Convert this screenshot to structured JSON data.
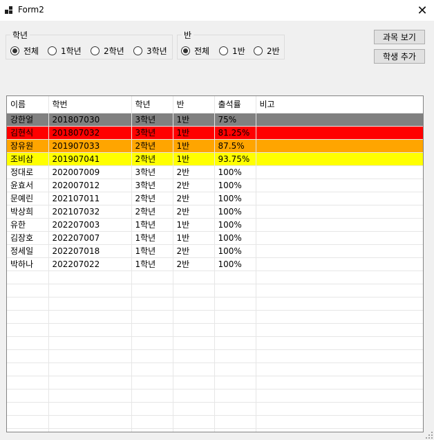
{
  "window": {
    "title": "Form2",
    "close_glyph": "✕"
  },
  "grade_group": {
    "label": "학년",
    "options": [
      {
        "label": "전체",
        "checked": true
      },
      {
        "label": "1학년",
        "checked": false
      },
      {
        "label": "2학년",
        "checked": false
      },
      {
        "label": "3학년",
        "checked": false
      }
    ]
  },
  "class_group": {
    "label": "반",
    "options": [
      {
        "label": "전체",
        "checked": true
      },
      {
        "label": "1반",
        "checked": false
      },
      {
        "label": "2반",
        "checked": false
      }
    ]
  },
  "buttons": {
    "view_subjects": "과목 보기",
    "add_student": "학생 추가"
  },
  "table": {
    "columns": [
      "이름",
      "학번",
      "학년",
      "반",
      "출석률",
      "비고"
    ],
    "rows": [
      {
        "name": "강한얼",
        "id": "201807030",
        "grade": "3학년",
        "class": "1반",
        "attendance": "75%",
        "note": "",
        "highlight": "#808080"
      },
      {
        "name": "김현식",
        "id": "201807032",
        "grade": "3학년",
        "class": "1반",
        "attendance": "81.25%",
        "note": "",
        "highlight": "#ff0000"
      },
      {
        "name": "장유원",
        "id": "201907033",
        "grade": "2학년",
        "class": "1반",
        "attendance": "87.5%",
        "note": "",
        "highlight": "#ffa500"
      },
      {
        "name": "조비삼",
        "id": "201907041",
        "grade": "2학년",
        "class": "1반",
        "attendance": "93.75%",
        "note": "",
        "highlight": "#ffff00"
      },
      {
        "name": "정대로",
        "id": "202007009",
        "grade": "3학년",
        "class": "2반",
        "attendance": "100%",
        "note": "",
        "highlight": ""
      },
      {
        "name": "윤효서",
        "id": "202007012",
        "grade": "3학년",
        "class": "2반",
        "attendance": "100%",
        "note": "",
        "highlight": ""
      },
      {
        "name": "문예린",
        "id": "202107011",
        "grade": "2학년",
        "class": "2반",
        "attendance": "100%",
        "note": "",
        "highlight": ""
      },
      {
        "name": "박상희",
        "id": "202107032",
        "grade": "2학년",
        "class": "2반",
        "attendance": "100%",
        "note": "",
        "highlight": ""
      },
      {
        "name": "유한",
        "id": "202207003",
        "grade": "1학년",
        "class": "1반",
        "attendance": "100%",
        "note": "",
        "highlight": ""
      },
      {
        "name": "김장호",
        "id": "202207007",
        "grade": "1학년",
        "class": "1반",
        "attendance": "100%",
        "note": "",
        "highlight": ""
      },
      {
        "name": "정세일",
        "id": "202207018",
        "grade": "1학년",
        "class": "2반",
        "attendance": "100%",
        "note": "",
        "highlight": ""
      },
      {
        "name": "박하나",
        "id": "202207022",
        "grade": "1학년",
        "class": "2반",
        "attendance": "100%",
        "note": "",
        "highlight": ""
      }
    ]
  },
  "colors": {
    "window_bg": "#f0f0f0",
    "grid_line": "#e6e6e6"
  },
  "icons": {
    "app": "app-icon",
    "close": "close-icon"
  }
}
